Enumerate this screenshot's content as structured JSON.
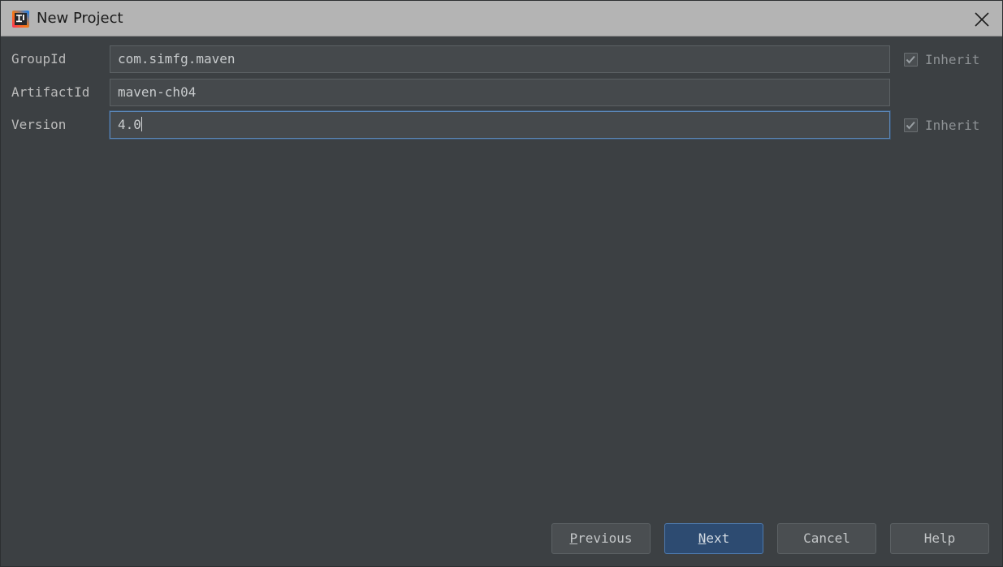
{
  "window": {
    "title": "New Project",
    "icon": "intellij-idea-icon",
    "close_icon": "close-icon",
    "titlebar_color": "#b4b4b4",
    "background_color": "#3c4043"
  },
  "form": {
    "rows": [
      {
        "label": "GroupId",
        "value": "com.simfg.maven",
        "placeholder": "",
        "focused": false,
        "inherit": {
          "label": "Inherit",
          "checked": true,
          "enabled": false
        }
      },
      {
        "label": "ArtifactId",
        "value": "maven-ch04",
        "placeholder": "",
        "focused": false,
        "inherit": null
      },
      {
        "label": "Version",
        "value": "4.0",
        "placeholder": "",
        "focused": true,
        "inherit": {
          "label": "Inherit",
          "checked": true,
          "enabled": false
        }
      }
    ]
  },
  "buttons": {
    "previous": {
      "label": "Previous",
      "mnemonic": "P",
      "default": false
    },
    "next": {
      "label": "Next",
      "mnemonic": "N",
      "default": true
    },
    "cancel": {
      "label": "Cancel",
      "mnemonic": "",
      "default": false
    },
    "help": {
      "label": "Help",
      "mnemonic": "",
      "default": false
    }
  },
  "colors": {
    "accent": "#2d4b71",
    "focus_border": "#5b87b8",
    "field_background": "#45494c",
    "text": "#c8cbcd"
  }
}
